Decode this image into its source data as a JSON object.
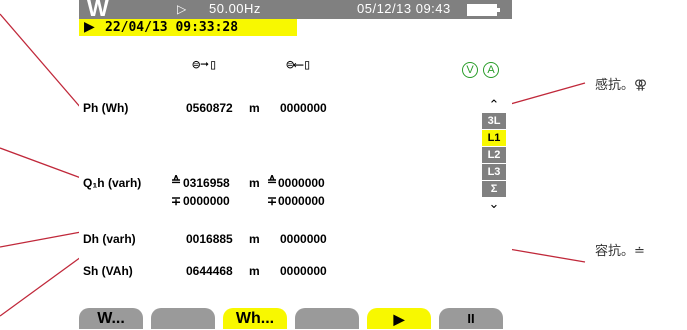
{
  "status": {
    "mode_glyph": "W",
    "frequency": "50.00Hz",
    "datetime": "05/12/13  09:43"
  },
  "record": {
    "timestamp": "22/04/13  09:33:28"
  },
  "indicators": {
    "v": "V",
    "a": "A"
  },
  "rows": [
    {
      "label": "Ph (Wh)",
      "consumed": "0560872",
      "unit": "m",
      "generated": "0000000"
    },
    {
      "label": "Q₁h (varh)",
      "consumed": "0316958",
      "unit": "m",
      "generated": "0000000",
      "consumed2": "0000000",
      "generated2": "0000000"
    },
    {
      "label": "Dh (varh)",
      "consumed": "0016885",
      "unit": "m",
      "generated": "0000000"
    },
    {
      "label": "Sh (VAh)",
      "consumed": "0644468",
      "unit": "m",
      "generated": "0000000"
    }
  ],
  "phase_tabs": [
    "3L",
    "L1",
    "L2",
    "L3",
    "Σ"
  ],
  "active_tab": "L1",
  "softkeys": [
    "W...",
    "",
    "Wh...",
    "",
    "▶",
    "II"
  ],
  "callouts": {
    "inductive": "感抗。⚢",
    "capacitive": "容抗。≐"
  }
}
